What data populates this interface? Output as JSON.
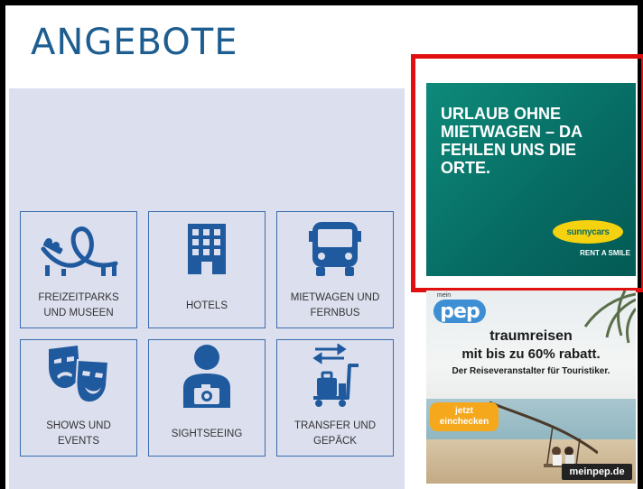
{
  "page": {
    "title": "ANGEBOTE"
  },
  "tiles": [
    {
      "label": "FREIZEITPARKS UND MUSEEN",
      "icon": "rollercoaster-icon"
    },
    {
      "label": "HOTELS",
      "icon": "hotel-icon"
    },
    {
      "label": "MIETWAGEN UND FERNBUS",
      "icon": "bus-icon"
    },
    {
      "label": "SHOWS UND EVENTS",
      "icon": "theater-masks-icon"
    },
    {
      "label": "SIGHTSEEING",
      "icon": "tourist-camera-icon"
    },
    {
      "label": "TRANSFER UND GEPÄCK",
      "icon": "luggage-cart-icon"
    }
  ],
  "ads": {
    "sunnycars": {
      "headline": "URLAUB OHNE MIETWAGEN – DA FEHLEN UNS DIE ORTE.",
      "logo": "sunnycars",
      "tagline": "RENT A SMILE",
      "background_color": "#0a7a6e"
    },
    "pep": {
      "logo_small": "mein",
      "logo": "pep",
      "line1": "traumreisen",
      "line2": "mit bis zu 60% rabatt.",
      "line3": "Der Reiseveranstalter für Touristiker.",
      "button": "jetzt einchecken",
      "url": "meinpep.de"
    }
  },
  "colors": {
    "title": "#1d5d90",
    "icon": "#1f5a9e",
    "panel": "#dcdfee",
    "highlight_border": "#e01010"
  }
}
